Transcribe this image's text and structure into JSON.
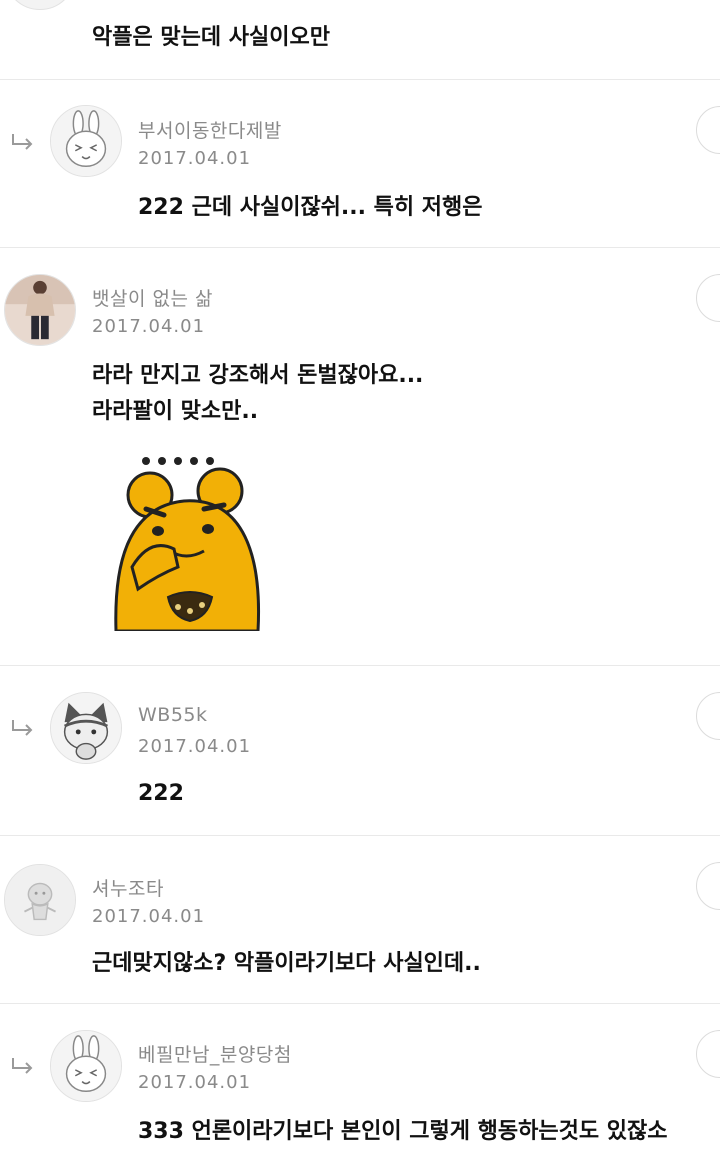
{
  "comments": [
    {
      "text": "악플은 맞는데 사실이오만"
    },
    {
      "reply": true,
      "nickname": "부서이동한다제발",
      "date": "2017.04.01",
      "text": "222 근데 사실이잖쉬... 특히 저행은",
      "avatar": "bunny-avatar"
    },
    {
      "reply": false,
      "nickname": "뱃살이 없는 삶",
      "date": "2017.04.01",
      "lines": [
        "라라 만지고 강조해서 돈벌잖아요...",
        "라라팔이 맞소만.."
      ],
      "avatar": "photo-avatar",
      "sticker": "bear-sticker"
    },
    {
      "reply": true,
      "nickname": "WB55k",
      "date": "2017.04.01",
      "text": "222",
      "avatar": "cat-avatar"
    },
    {
      "reply": false,
      "nickname": "셔누조타",
      "date": "2017.04.01",
      "text": "근데맞지않소? 악플이라기보다 사실인데..",
      "avatar": "default-avatar"
    },
    {
      "reply": true,
      "nickname": "베필만남_분양당첨",
      "date": "2017.04.01",
      "text": "333 언론이라기보다 본인이 그렇게 행동하는것도 있잖소",
      "avatar": "bunny-avatar"
    }
  ],
  "colors": {
    "meta": "#8a8a8a",
    "divider": "#e9e9e9",
    "sticker_fill": "#f2b006"
  }
}
